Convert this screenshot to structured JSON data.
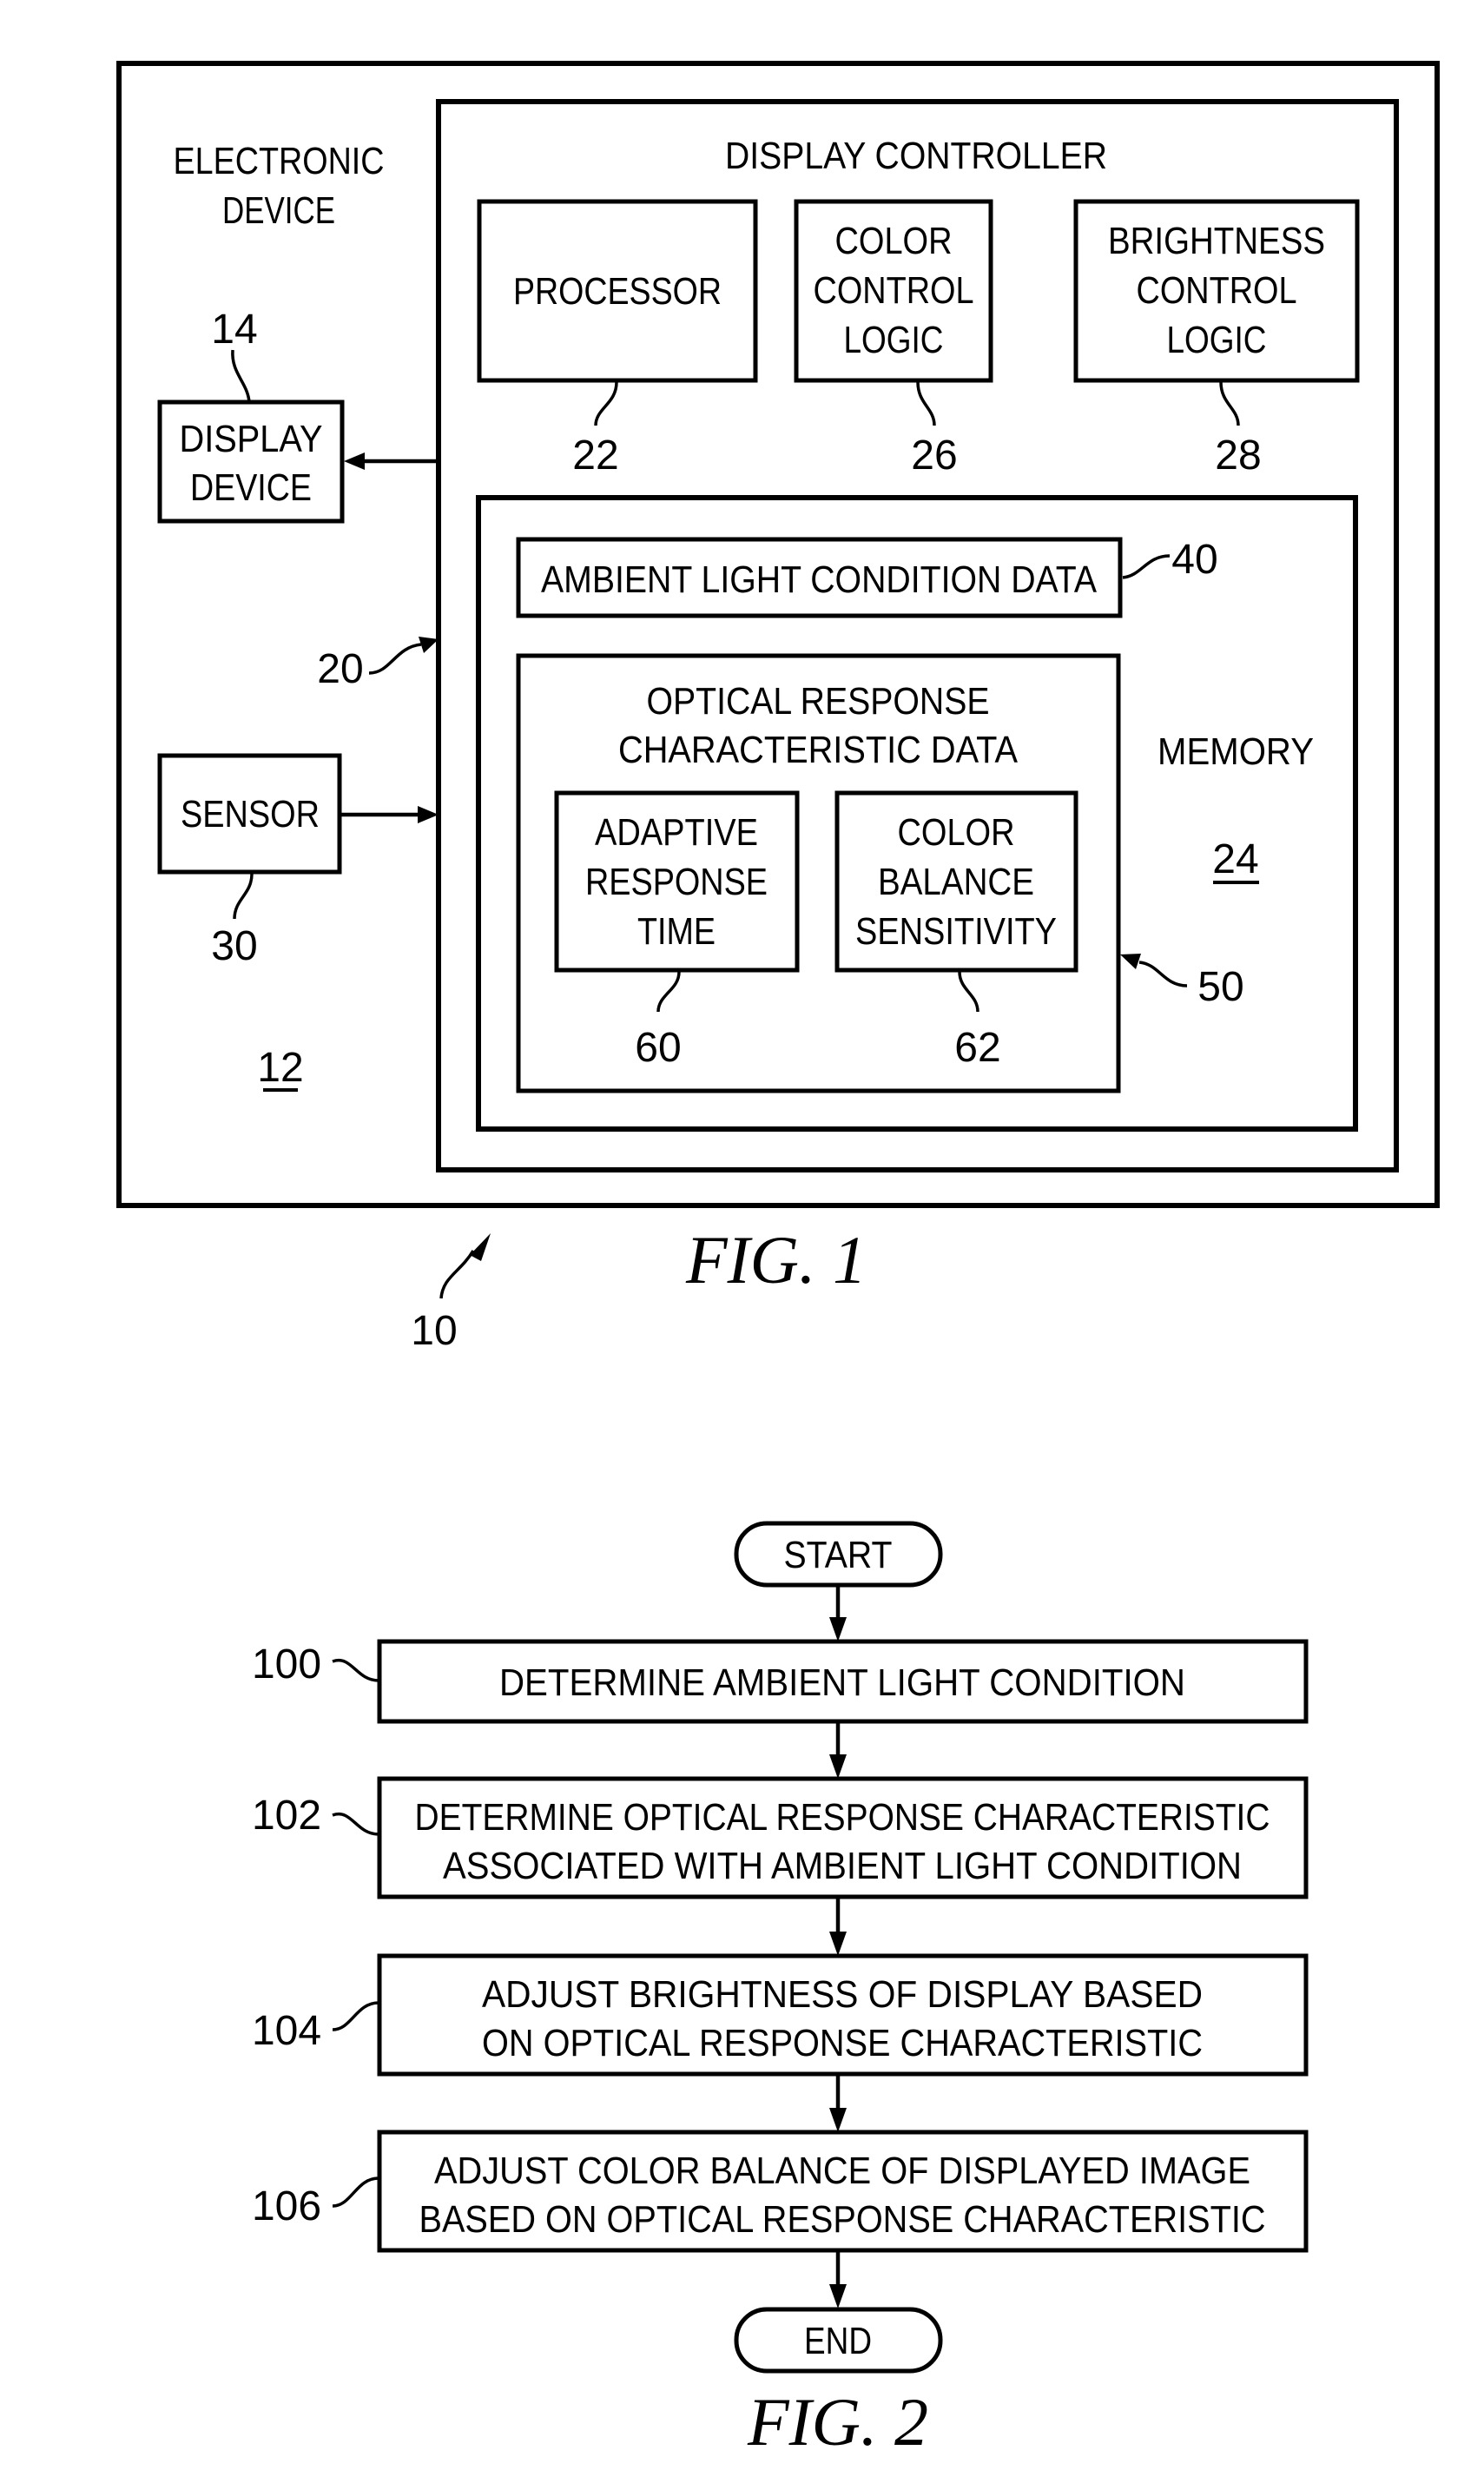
{
  "fig1": {
    "caption": "FIG. 1",
    "system_ref": "10",
    "electronic_device": {
      "label_lines": [
        "ELECTRONIC",
        "DEVICE"
      ],
      "ref": "12"
    },
    "display_device": {
      "label_lines": [
        "DISPLAY",
        "DEVICE"
      ],
      "ref": "14"
    },
    "sensor": {
      "label_lines": [
        "SENSOR"
      ],
      "ref": "30"
    },
    "display_controller": {
      "title": "DISPLAY CONTROLLER",
      "ref": "20",
      "processor": {
        "label_lines": [
          "PROCESSOR"
        ],
        "ref": "22"
      },
      "color_control_logic": {
        "label_lines": [
          "COLOR",
          "CONTROL",
          "LOGIC"
        ],
        "ref": "26"
      },
      "brightness_control_logic": {
        "label_lines": [
          "BRIGHTNESS",
          "CONTROL",
          "LOGIC"
        ],
        "ref": "28"
      },
      "memory": {
        "title": "MEMORY",
        "ref": "24",
        "ambient_light_condition_data": {
          "label": "AMBIENT LIGHT CONDITION DATA",
          "ref": "40"
        },
        "optical_response_characteristic_data": {
          "label_lines": [
            "OPTICAL RESPONSE",
            "CHARACTERISTIC DATA"
          ],
          "ref": "50",
          "adaptive_response_time": {
            "label_lines": [
              "ADAPTIVE",
              "RESPONSE",
              "TIME"
            ],
            "ref": "60"
          },
          "color_balance_sensitivity": {
            "label_lines": [
              "COLOR",
              "BALANCE",
              "SENSITIVITY"
            ],
            "ref": "62"
          }
        }
      }
    }
  },
  "fig2": {
    "caption": "FIG. 2",
    "start": "START",
    "end": "END",
    "steps": [
      {
        "ref": "100",
        "lines": [
          "DETERMINE AMBIENT LIGHT CONDITION"
        ]
      },
      {
        "ref": "102",
        "lines": [
          "DETERMINE OPTICAL RESPONSE CHARACTERISTIC",
          "ASSOCIATED WITH AMBIENT LIGHT CONDITION"
        ]
      },
      {
        "ref": "104",
        "lines": [
          "ADJUST BRIGHTNESS OF DISPLAY BASED",
          "ON OPTICAL RESPONSE CHARACTERISTIC"
        ]
      },
      {
        "ref": "106",
        "lines": [
          "ADJUST COLOR BALANCE OF DISPLAYED IMAGE",
          "BASED ON OPTICAL RESPONSE CHARACTERISTIC"
        ]
      }
    ]
  }
}
